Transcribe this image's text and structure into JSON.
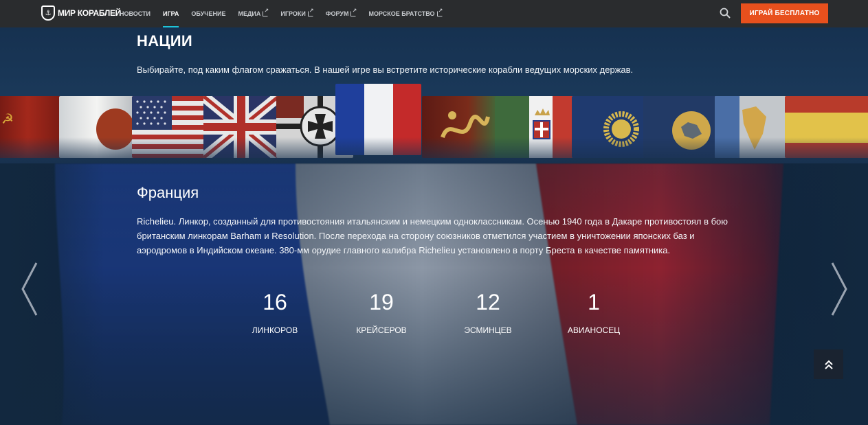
{
  "header": {
    "logo_text": "МИР КОРАБЛЕЙ",
    "nav": [
      {
        "label": "Новости",
        "external": false,
        "active": false
      },
      {
        "label": "Игра",
        "external": false,
        "active": true
      },
      {
        "label": "Обучение",
        "external": false,
        "active": false
      },
      {
        "label": "Медиа",
        "external": true,
        "active": false
      },
      {
        "label": "Игроки",
        "external": true,
        "active": false
      },
      {
        "label": "Форум",
        "external": true,
        "active": false
      },
      {
        "label": "Морское братство",
        "external": true,
        "active": false
      }
    ],
    "search_icon": "search-icon",
    "play_label": "Играй бесплатно"
  },
  "section": {
    "title": "НАЦИИ",
    "description": "Выбирайте, под каким флагом сражаться. В нашей игре вы встретите исторические корабли ведущих морских держав."
  },
  "flags": [
    {
      "id": "ussr"
    },
    {
      "id": "japan"
    },
    {
      "id": "usa"
    },
    {
      "id": "uk"
    },
    {
      "id": "germany"
    },
    {
      "id": "france",
      "active": true
    },
    {
      "id": "pan-asia"
    },
    {
      "id": "italy"
    },
    {
      "id": "commonwealth"
    },
    {
      "id": "europe"
    },
    {
      "id": "pan-america"
    },
    {
      "id": "spain"
    }
  ],
  "nation": {
    "title": "Франция",
    "description": "Richelieu. Линкор, созданный для противостояния итальянским и немецким одноклассникам. Осенью 1940 года в Дакаре противостоял в бою британским линкорам Barham и Resolution. После перехода на сторону союзников отметился участием в уничтожении японских баз и аэродромов в Индийском океане. 380-мм орудие главного калибра Richelieu установлено в порту Бреста в качестве памятника.",
    "stats": [
      {
        "value": "16",
        "label": "Линкоров"
      },
      {
        "value": "19",
        "label": "Крейсеров"
      },
      {
        "value": "12",
        "label": "Эсминцев"
      },
      {
        "value": "1",
        "label": "Авианосец"
      }
    ]
  },
  "colors": {
    "accent": "#1fc3d6",
    "play_button": "#e8501d",
    "header_bg": "#2a2c2e",
    "page_bg": "#12283f"
  }
}
